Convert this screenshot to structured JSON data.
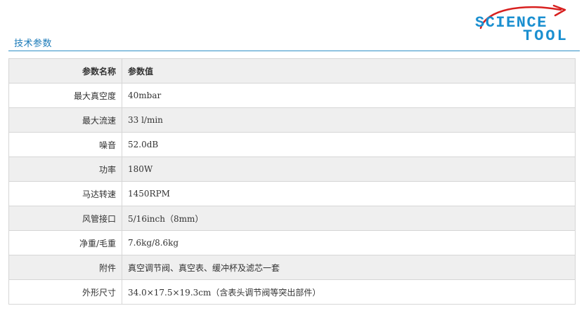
{
  "logo": {
    "line1": "SCIENCE",
    "line2": "TOOL",
    "color_text": "#1a8fd0",
    "color_swoosh": "#d8201f"
  },
  "section": {
    "title": "技术参数"
  },
  "table": {
    "header": {
      "key": "参数名称",
      "value": "参数值"
    },
    "rows": [
      {
        "key": "最大真空度",
        "value": "40mbar"
      },
      {
        "key": "最大流速",
        "value": "33 l/min"
      },
      {
        "key": "噪音",
        "value": "52.0dB"
      },
      {
        "key": "功率",
        "value": "180W"
      },
      {
        "key": "马达转速",
        "value": "1450RPM"
      },
      {
        "key": "风管接口",
        "value": "5/16inch（8mm）"
      },
      {
        "key": "净重/毛重",
        "value": "7.6kg/8.6kg"
      },
      {
        "key": "附件",
        "value": "真空调节阀、真空表、缓冲杯及滤芯一套"
      },
      {
        "key": "外形尺寸",
        "value": "34.0×17.5×19.3cm（含表头调节阀等突出部件）"
      }
    ]
  },
  "colors": {
    "accent": "#2f8fc6",
    "row_alt": "#efefef",
    "border": "#d6d6d6"
  }
}
